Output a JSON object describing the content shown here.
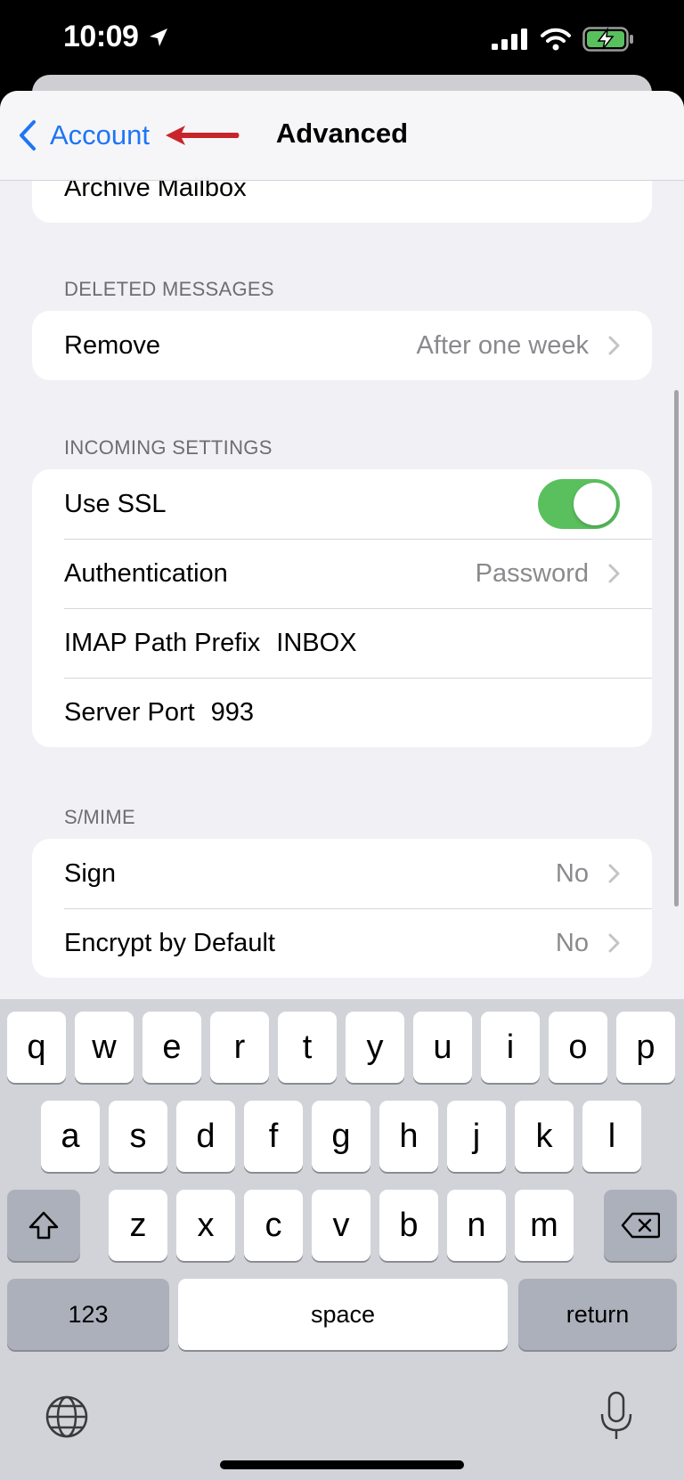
{
  "status_bar": {
    "time": "10:09"
  },
  "nav": {
    "back_label": "Account",
    "title": "Advanced"
  },
  "partial_row": {
    "label": "Archive Mailbox"
  },
  "deleted_messages": {
    "header": "DELETED MESSAGES",
    "remove": {
      "label": "Remove",
      "value": "After one week"
    }
  },
  "incoming_settings": {
    "header": "INCOMING SETTINGS",
    "use_ssl": {
      "label": "Use SSL",
      "enabled": true
    },
    "authentication": {
      "label": "Authentication",
      "value": "Password"
    },
    "imap_path_prefix": {
      "label": "IMAP Path Prefix",
      "value": "INBOX"
    },
    "server_port": {
      "label": "Server Port",
      "value": "993"
    }
  },
  "smime": {
    "header": "S/MIME",
    "sign": {
      "label": "Sign",
      "value": "No"
    },
    "encrypt": {
      "label": "Encrypt by Default",
      "value": "No"
    }
  },
  "keyboard": {
    "row1": [
      "q",
      "w",
      "e",
      "r",
      "t",
      "y",
      "u",
      "i",
      "o",
      "p"
    ],
    "row2": [
      "a",
      "s",
      "d",
      "f",
      "g",
      "h",
      "j",
      "k",
      "l"
    ],
    "row3": [
      "z",
      "x",
      "c",
      "v",
      "b",
      "n",
      "m"
    ],
    "numbers_label": "123",
    "space_label": "space",
    "return_label": "return"
  },
  "colors": {
    "accent": "#1f75f5",
    "toggle_on": "#5ac05e",
    "annotation_arrow": "#c8252b"
  },
  "icons": [
    "location-arrow-icon",
    "signal-icon",
    "wifi-icon",
    "battery-charging-icon",
    "chevron-left-icon",
    "chevron-right-icon",
    "shift-icon",
    "delete-icon",
    "globe-icon",
    "microphone-icon"
  ]
}
